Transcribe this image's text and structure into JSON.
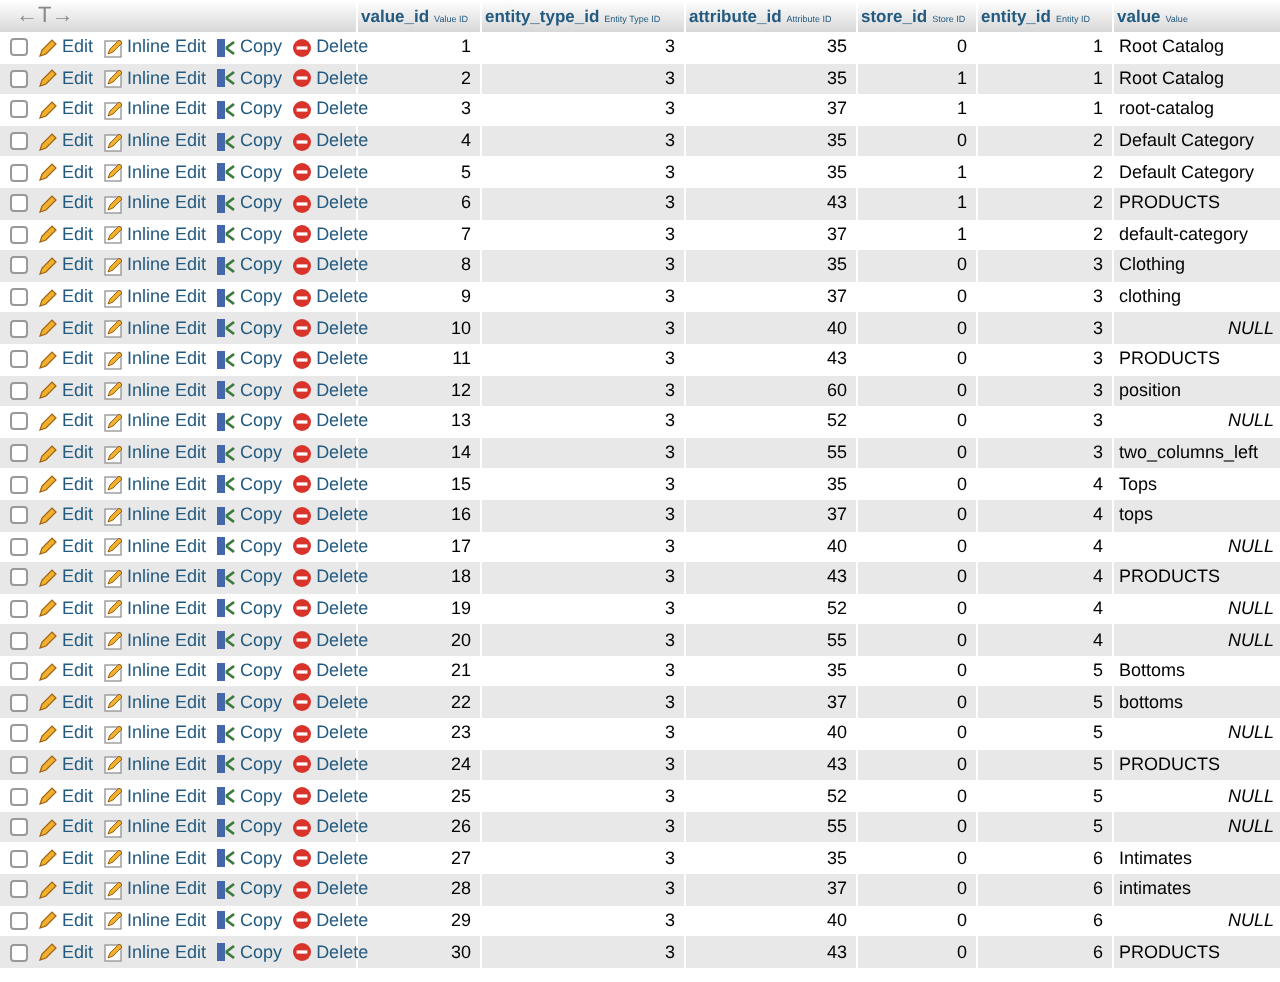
{
  "header": {
    "resize_handle": "←T→",
    "columns": [
      {
        "name": "value_id",
        "comment": "Value ID"
      },
      {
        "name": "entity_type_id",
        "comment": "Entity Type ID"
      },
      {
        "name": "attribute_id",
        "comment": "Attribute ID"
      },
      {
        "name": "store_id",
        "comment": "Store ID"
      },
      {
        "name": "entity_id",
        "comment": "Entity ID"
      },
      {
        "name": "value",
        "comment": "Value"
      }
    ]
  },
  "rows": [
    {
      "checked": false,
      "actions": [
        "Edit",
        "Inline Edit",
        "Copy",
        "Delete"
      ],
      "cells": [
        "1",
        "3",
        "35",
        "0",
        "1"
      ],
      "value": "Root Catalog",
      "null": false
    },
    {
      "checked": false,
      "actions": [
        "Edit",
        "Inline Edit",
        "Copy",
        "Delete"
      ],
      "cells": [
        "2",
        "3",
        "35",
        "1",
        "1"
      ],
      "value": "Root Catalog",
      "null": false
    },
    {
      "checked": false,
      "actions": [
        "Edit",
        "Inline Edit",
        "Copy",
        "Delete"
      ],
      "cells": [
        "3",
        "3",
        "37",
        "1",
        "1"
      ],
      "value": "root-catalog",
      "null": false
    },
    {
      "checked": false,
      "actions": [
        "Edit",
        "Inline Edit",
        "Copy",
        "Delete"
      ],
      "cells": [
        "4",
        "3",
        "35",
        "0",
        "2"
      ],
      "value": "Default Category",
      "null": false
    },
    {
      "checked": false,
      "actions": [
        "Edit",
        "Inline Edit",
        "Copy",
        "Delete"
      ],
      "cells": [
        "5",
        "3",
        "35",
        "1",
        "2"
      ],
      "value": "Default Category",
      "null": false
    },
    {
      "checked": false,
      "actions": [
        "Edit",
        "Inline Edit",
        "Copy",
        "Delete"
      ],
      "cells": [
        "6",
        "3",
        "43",
        "1",
        "2"
      ],
      "value": "PRODUCTS",
      "null": false
    },
    {
      "checked": false,
      "actions": [
        "Edit",
        "Inline Edit",
        "Copy",
        "Delete"
      ],
      "cells": [
        "7",
        "3",
        "37",
        "1",
        "2"
      ],
      "value": "default-category",
      "null": false
    },
    {
      "checked": false,
      "actions": [
        "Edit",
        "Inline Edit",
        "Copy",
        "Delete"
      ],
      "cells": [
        "8",
        "3",
        "35",
        "0",
        "3"
      ],
      "value": "Clothing",
      "null": false
    },
    {
      "checked": false,
      "actions": [
        "Edit",
        "Inline Edit",
        "Copy",
        "Delete"
      ],
      "cells": [
        "9",
        "3",
        "37",
        "0",
        "3"
      ],
      "value": "clothing",
      "null": false
    },
    {
      "checked": false,
      "actions": [
        "Edit",
        "Inline Edit",
        "Copy",
        "Delete"
      ],
      "cells": [
        "10",
        "3",
        "40",
        "0",
        "3"
      ],
      "value": "NULL",
      "null": true
    },
    {
      "checked": false,
      "actions": [
        "Edit",
        "Inline Edit",
        "Copy",
        "Delete"
      ],
      "cells": [
        "11",
        "3",
        "43",
        "0",
        "3"
      ],
      "value": "PRODUCTS",
      "null": false
    },
    {
      "checked": false,
      "actions": [
        "Edit",
        "Inline Edit",
        "Copy",
        "Delete"
      ],
      "cells": [
        "12",
        "3",
        "60",
        "0",
        "3"
      ],
      "value": "position",
      "null": false
    },
    {
      "checked": false,
      "actions": [
        "Edit",
        "Inline Edit",
        "Copy",
        "Delete"
      ],
      "cells": [
        "13",
        "3",
        "52",
        "0",
        "3"
      ],
      "value": "NULL",
      "null": true
    },
    {
      "checked": false,
      "actions": [
        "Edit",
        "Inline Edit",
        "Copy",
        "Delete"
      ],
      "cells": [
        "14",
        "3",
        "55",
        "0",
        "3"
      ],
      "value": "two_columns_left",
      "null": false
    },
    {
      "checked": false,
      "actions": [
        "Edit",
        "Inline Edit",
        "Copy",
        "Delete"
      ],
      "cells": [
        "15",
        "3",
        "35",
        "0",
        "4"
      ],
      "value": "Tops",
      "null": false
    },
    {
      "checked": false,
      "actions": [
        "Edit",
        "Inline Edit",
        "Copy",
        "Delete"
      ],
      "cells": [
        "16",
        "3",
        "37",
        "0",
        "4"
      ],
      "value": "tops",
      "null": false
    },
    {
      "checked": false,
      "actions": [
        "Edit",
        "Inline Edit",
        "Copy",
        "Delete"
      ],
      "cells": [
        "17",
        "3",
        "40",
        "0",
        "4"
      ],
      "value": "NULL",
      "null": true
    },
    {
      "checked": false,
      "actions": [
        "Edit",
        "Inline Edit",
        "Copy",
        "Delete"
      ],
      "cells": [
        "18",
        "3",
        "43",
        "0",
        "4"
      ],
      "value": "PRODUCTS",
      "null": false
    },
    {
      "checked": false,
      "actions": [
        "Edit",
        "Inline Edit",
        "Copy",
        "Delete"
      ],
      "cells": [
        "19",
        "3",
        "52",
        "0",
        "4"
      ],
      "value": "NULL",
      "null": true
    },
    {
      "checked": false,
      "actions": [
        "Edit",
        "Inline Edit",
        "Copy",
        "Delete"
      ],
      "cells": [
        "20",
        "3",
        "55",
        "0",
        "4"
      ],
      "value": "NULL",
      "null": true
    },
    {
      "checked": false,
      "actions": [
        "Edit",
        "Inline Edit",
        "Copy",
        "Delete"
      ],
      "cells": [
        "21",
        "3",
        "35",
        "0",
        "5"
      ],
      "value": "Bottoms",
      "null": false
    },
    {
      "checked": false,
      "actions": [
        "Edit",
        "Inline Edit",
        "Copy",
        "Delete"
      ],
      "cells": [
        "22",
        "3",
        "37",
        "0",
        "5"
      ],
      "value": "bottoms",
      "null": false
    },
    {
      "checked": false,
      "actions": [
        "Edit",
        "Inline Edit",
        "Copy",
        "Delete"
      ],
      "cells": [
        "23",
        "3",
        "40",
        "0",
        "5"
      ],
      "value": "NULL",
      "null": true
    },
    {
      "checked": false,
      "actions": [
        "Edit",
        "Inline Edit",
        "Copy",
        "Delete"
      ],
      "cells": [
        "24",
        "3",
        "43",
        "0",
        "5"
      ],
      "value": "PRODUCTS",
      "null": false
    },
    {
      "checked": false,
      "actions": [
        "Edit",
        "Inline Edit",
        "Copy",
        "Delete"
      ],
      "cells": [
        "25",
        "3",
        "52",
        "0",
        "5"
      ],
      "value": "NULL",
      "null": true
    },
    {
      "checked": false,
      "actions": [
        "Edit",
        "Inline Edit",
        "Copy",
        "Delete"
      ],
      "cells": [
        "26",
        "3",
        "55",
        "0",
        "5"
      ],
      "value": "NULL",
      "null": true
    },
    {
      "checked": false,
      "actions": [
        "Edit",
        "Inline Edit",
        "Copy",
        "Delete"
      ],
      "cells": [
        "27",
        "3",
        "35",
        "0",
        "6"
      ],
      "value": "Intimates",
      "null": false
    },
    {
      "checked": false,
      "actions": [
        "Edit",
        "Inline Edit",
        "Copy",
        "Delete"
      ],
      "cells": [
        "28",
        "3",
        "37",
        "0",
        "6"
      ],
      "value": "intimates",
      "null": false
    },
    {
      "checked": false,
      "actions": [
        "Edit",
        "Inline Edit",
        "Copy",
        "Delete"
      ],
      "cells": [
        "29",
        "3",
        "40",
        "0",
        "6"
      ],
      "value": "NULL",
      "null": true
    },
    {
      "checked": false,
      "actions": [
        "Edit",
        "Inline Edit",
        "Copy",
        "Delete"
      ],
      "cells": [
        "30",
        "3",
        "43",
        "0",
        "6"
      ],
      "value": "PRODUCTS",
      "null": false
    }
  ]
}
